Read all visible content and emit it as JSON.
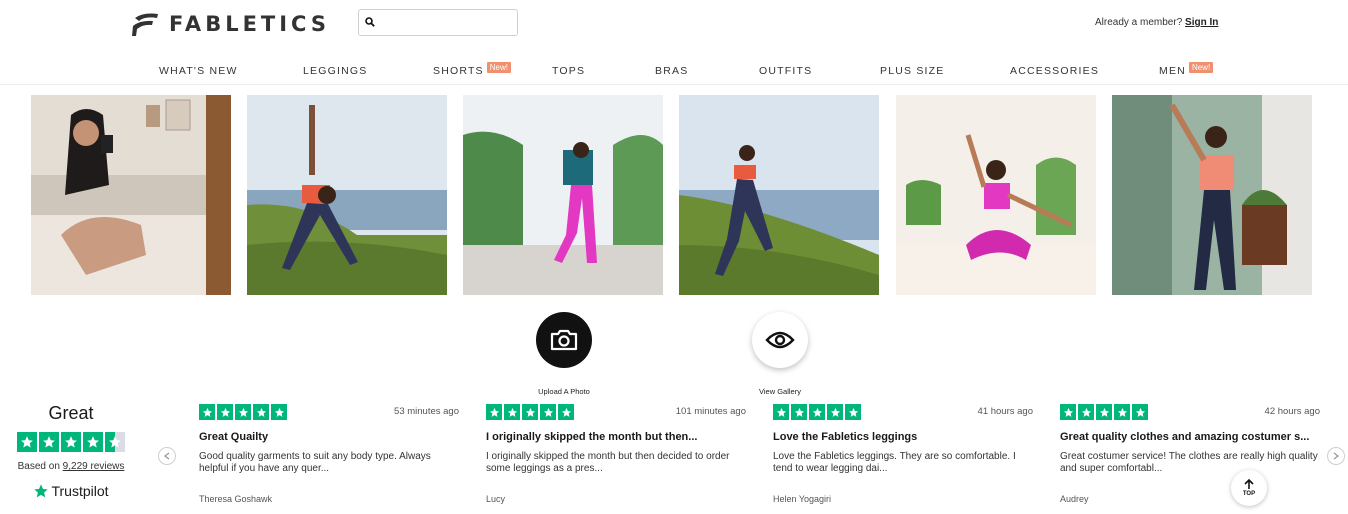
{
  "header": {
    "logo_text": "FABLETICS",
    "search_placeholder": "",
    "member_prompt": "Already a member?",
    "sign_in": "Sign In"
  },
  "nav": {
    "items": [
      {
        "label": "WHAT'S NEW"
      },
      {
        "label": "LEGGINGS"
      },
      {
        "label": "SHORTS",
        "badge": "New!"
      },
      {
        "label": "TOPS"
      },
      {
        "label": "BRAS"
      },
      {
        "label": "OUTFITS"
      },
      {
        "label": "PLUS SIZE"
      },
      {
        "label": "ACCESSORIES"
      },
      {
        "label": "MEN",
        "badge": "New!"
      }
    ]
  },
  "gallery": {
    "photos": [
      {
        "icon": "mirror-selfie-photo"
      },
      {
        "icon": "yoga-pose-coast-photo"
      },
      {
        "icon": "running-pink-leggings-photo"
      },
      {
        "icon": "running-coast-photo"
      },
      {
        "icon": "yoga-tree-pose-photo"
      },
      {
        "icon": "street-pose-photo"
      }
    ]
  },
  "actions": {
    "upload_label": "Upload A Photo",
    "gallery_label": "View Gallery"
  },
  "trustpilot": {
    "rating_word": "Great",
    "based_on": "Based on",
    "review_count": "9,229 reviews",
    "brand": "Trustpilot",
    "stars_filled": 4.5
  },
  "reviews": [
    {
      "time": "53 minutes ago",
      "title": "Great Quailty",
      "body": "Good quality garments to suit any body type. Always helpful if you have any quer...",
      "author": "Theresa Goshawk"
    },
    {
      "time": "101 minutes ago",
      "title": "I originally skipped the month but then...",
      "body": "I originally skipped the month but then decided to order some leggings as a pres...",
      "author": "Lucy"
    },
    {
      "time": "41 hours ago",
      "title": "Love the Fabletics leggings",
      "body": "Love the Fabletics leggings. They are so comfortable. I tend to wear legging dai...",
      "author": "Helen Yogagiri"
    },
    {
      "time": "42 hours ago",
      "title": "Great quality clothes and amazing costumer s...",
      "body": "Great costumer service! The clothes are really high quality and super comfortabl...",
      "author": "Audrey"
    }
  ],
  "top_button": "TOP",
  "colors": {
    "trustpilot_green": "#00b67a",
    "badge": "#f0906e"
  }
}
